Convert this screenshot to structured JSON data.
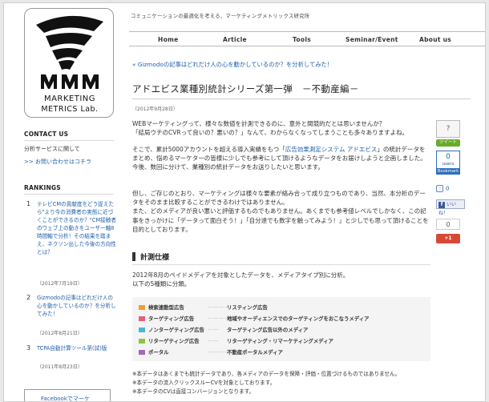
{
  "logo": {
    "line1": "MARKETING",
    "line2": "METRICS Lab."
  },
  "header": {
    "tagline": "コミュニケーションの最適化を考える、マーケティングメトリックス研究所"
  },
  "nav": [
    {
      "label": "Home"
    },
    {
      "label": "Article"
    },
    {
      "label": "Tools"
    },
    {
      "label": "Seminar/Event"
    },
    {
      "label": "About us"
    }
  ],
  "sidebar": {
    "contact_heading": "CONTACT US",
    "contact_item": "分析サービスに関して",
    "contact_link": ">> お問い合わせはコチラ",
    "rankings_heading": "RANKINGS",
    "rankings": [
      {
        "num": "1",
        "title": "テレビCMの貢献度をどう捉えたら\"より今の消費者の実態に近づくことができるのか？\"CM接触者のウェブ上の動きをユーザー軸8時間軸で分析！その結果を踏まえ、ネクソン出した今後の方向性とは？",
        "date": "（2012年7月19日）"
      },
      {
        "num": "2",
        "title": "Gizmodoの記事はどれだけ人の心を動かしているのか？を分析してみた！",
        "date": "（2012年8月21日）"
      },
      {
        "num": "3",
        "title": "TCPA自動計算ツール第(試)版",
        "date": "（2011年8月23日）"
      }
    ],
    "fb_label": "Facebookでマーケ"
  },
  "article": {
    "prev_link": "« Gizmodoの記事はどれだけ人の心を動かしているのか？を分析してみた！",
    "title": "アドエビス業種別統計シリーズ第一弾　－不動産編－",
    "date": "（2012年9月28日）",
    "p1": [
      "WEBマーケティングって、様々な数値を計測できるのに、意外と間競的だとは思いませんか？",
      "「結局ウチのCVRって良いの？悪いの？」なんて、わからなくなってしまうことも多々ありますよね。"
    ],
    "p2_before": "そこで、累計5000アカウントを超える導入実績をもつ「",
    "p2_link": "広告効果測定システム アドエビス",
    "p2_after": "」の統計データをまとめ、悩めるマーケターの皆様に少しでも参考にして頂けるようなデータをお届けしようと企画しました。",
    "p2_last": "今後、数回に分けて、業種別の統計データをお送りしたいと思います。",
    "p3": [
      "但し、ご存じのとおり、マーケティングは様々な要素が絡み合って成り立つものであり、当然、本分析のデータをそのまま比較することができるわけではありません。",
      "また、どのメディアが良い悪いと評価するものでもありません。あくまでも参考値レベルでしかなく、この記事をきっかけに「データって面白そう！」「自分達でも数字を触ってみよう！」と少しでも思って頂けることを目的としております。"
    ],
    "section_title": "計測仕様",
    "spec": [
      "2012年8月のペイドメディアを対象としたデータを、メディアタイプ別に分析。",
      "以下の5種類に分類。"
    ],
    "legend": [
      {
        "category": "検索連動型広告",
        "dots": "…………",
        "desc": "リスティング広告",
        "color": "#f0a030"
      },
      {
        "category": "ターゲティング広告",
        "dots": "…………",
        "desc": "地域やオーディエンスでのターゲティングをおこなうメディア",
        "color": "#e6607a"
      },
      {
        "category": "ノンターゲティング広告",
        "dots": "……",
        "desc": "ターゲティング広告以外のメディア",
        "color": "#49b8d8"
      },
      {
        "category": "リターゲティング広告",
        "dots": "……",
        "desc": "リターゲティング・リマーケティングメディア",
        "color": "#8cc63f"
      },
      {
        "category": "ポータル",
        "dots": "…………",
        "desc": "不動産ポータルメディア",
        "color": "#a766b8"
      }
    ],
    "notes": [
      "※本データはあくまでも統計データであり、各メディアのデータを保障・評価・位置づけるものではありません。",
      "※本データの流入クリックスルーCVを対象としております。",
      "※本データのCVは直接コンバージョンとなります。"
    ]
  },
  "social": {
    "question": "?",
    "tweet": "ツイート",
    "hatena_count": "0",
    "hatena_users": "users",
    "hatena_bookmark": "Bookmark",
    "like_count": "0",
    "fb_like": "いいね！",
    "gplus_count": "0",
    "gplus_label": "+1"
  }
}
